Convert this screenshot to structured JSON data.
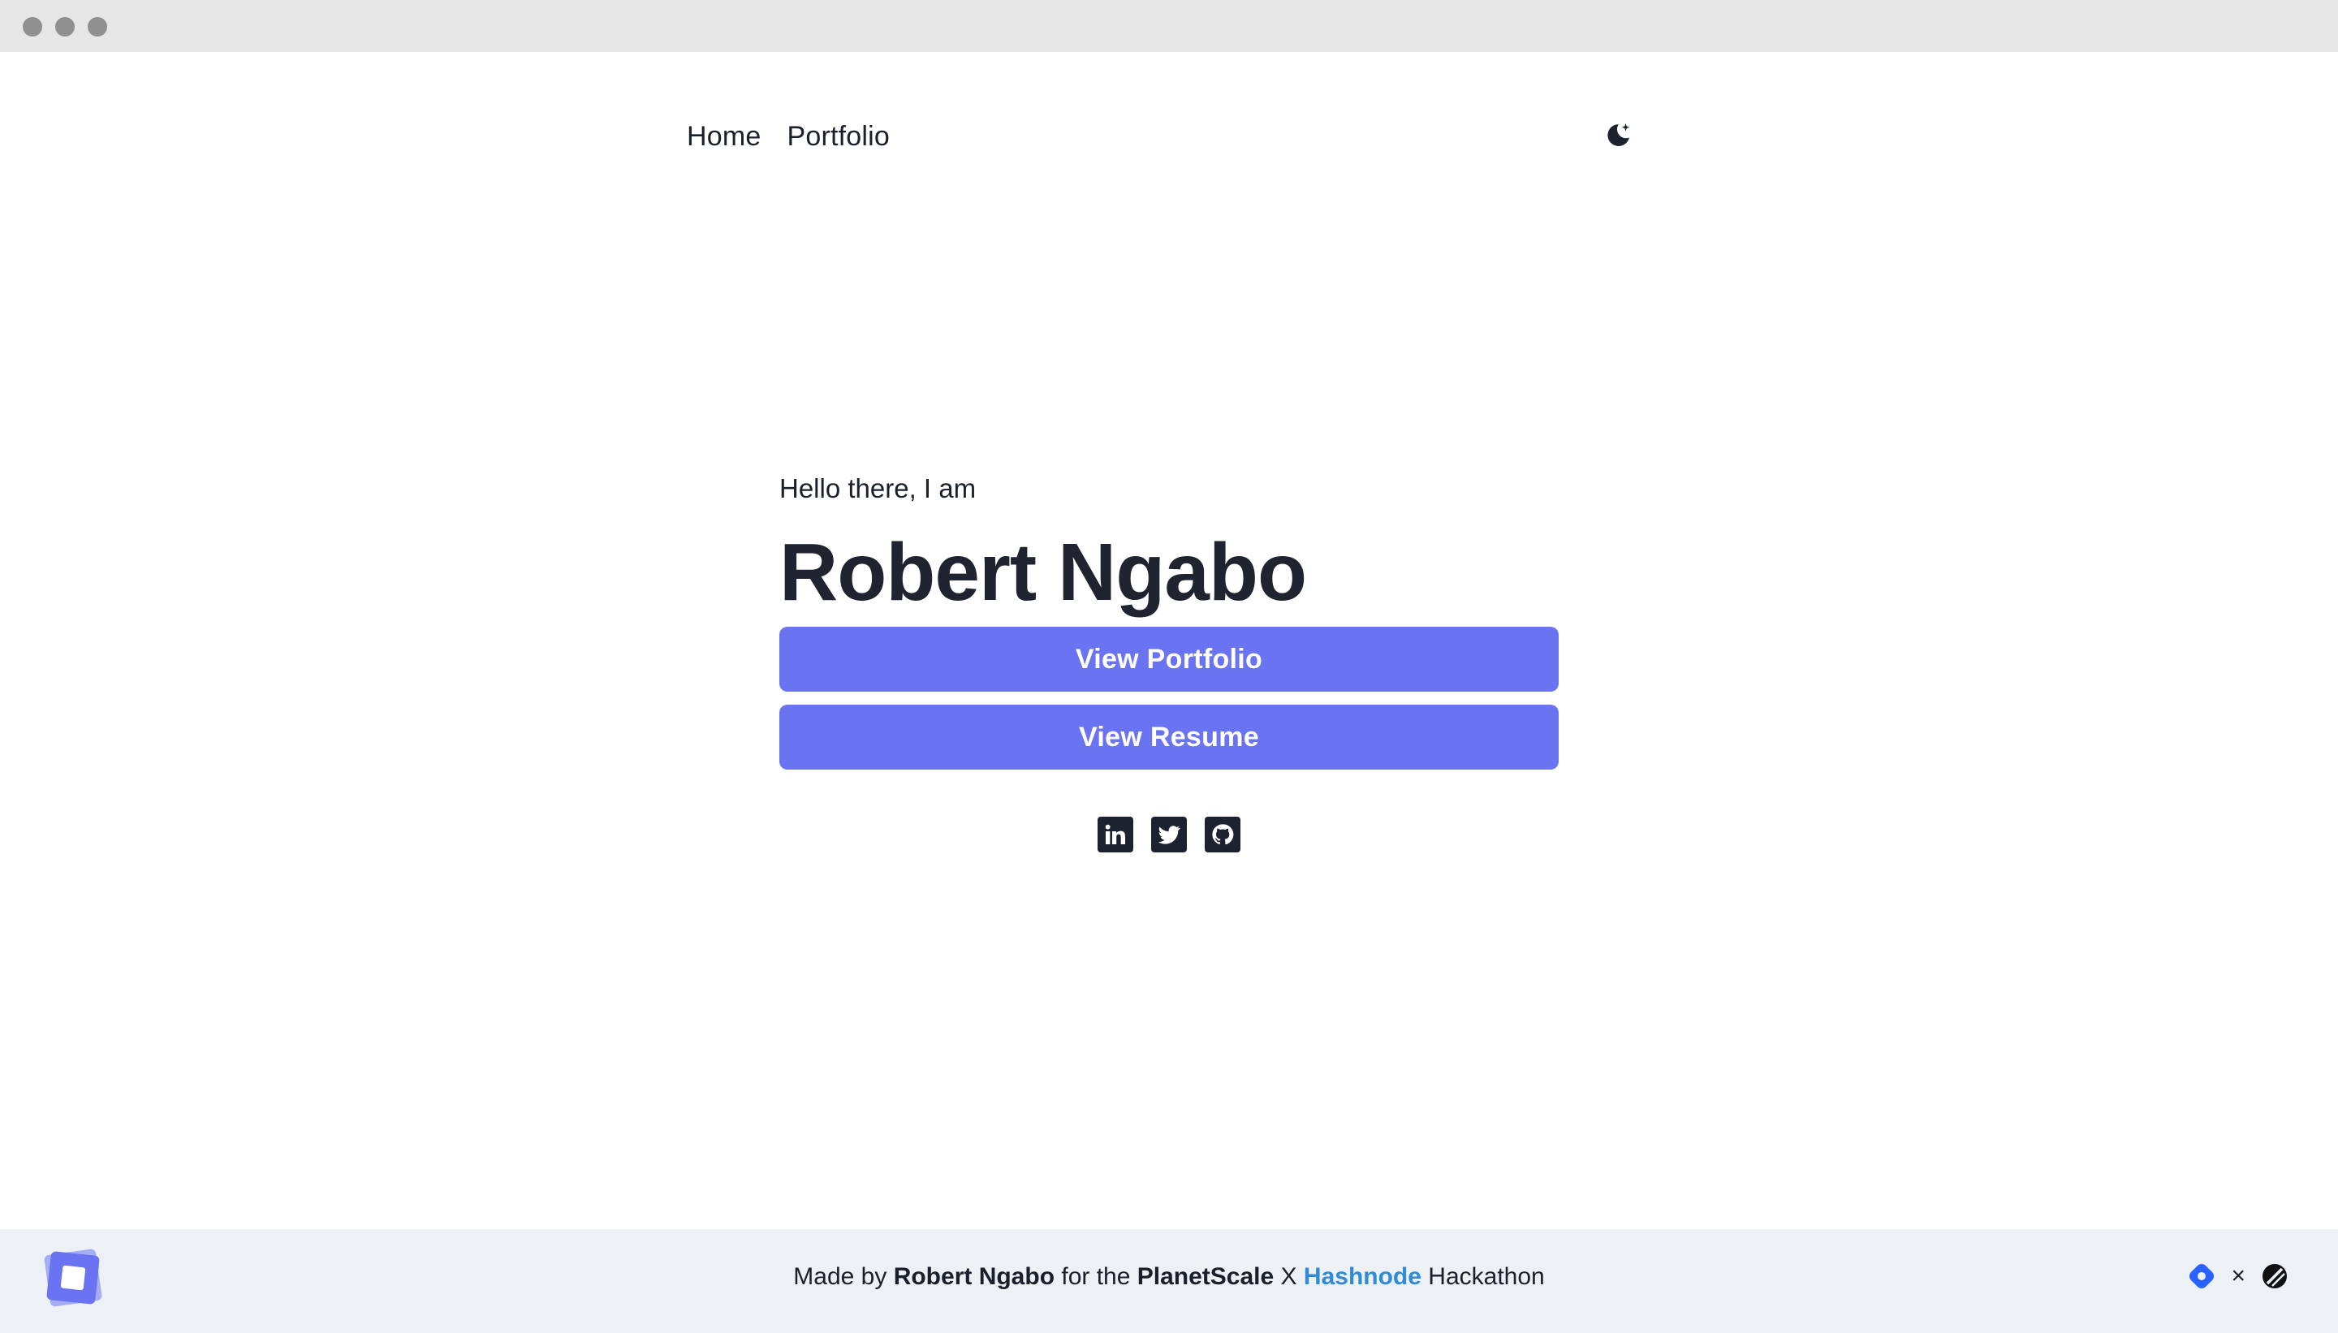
{
  "nav": {
    "home_label": "Home",
    "portfolio_label": "Portfolio",
    "theme_toggle_icon": "moon-sparkle-icon"
  },
  "hero": {
    "greeting": "Hello there, I am",
    "name": "Robert Ngabo",
    "view_portfolio_label": "View Portfolio",
    "view_resume_label": "View Resume"
  },
  "socials": [
    {
      "icon": "linkedin-icon"
    },
    {
      "icon": "twitter-icon"
    },
    {
      "icon": "github-icon"
    }
  ],
  "footer": {
    "made_by": "Made by",
    "author": "Robert Ngabo",
    "for_the": "for the",
    "planetscale": "PlanetScale",
    "x": "X",
    "hashnode": "Hashnode",
    "hackathon": "Hackathon",
    "times": "×"
  },
  "colors": {
    "accent": "#6a74f2",
    "text": "#1a1f2c",
    "footer_bg": "#edf1f6",
    "hashnode_blue": "#2e8bd8",
    "logo": "#6a74f2"
  }
}
